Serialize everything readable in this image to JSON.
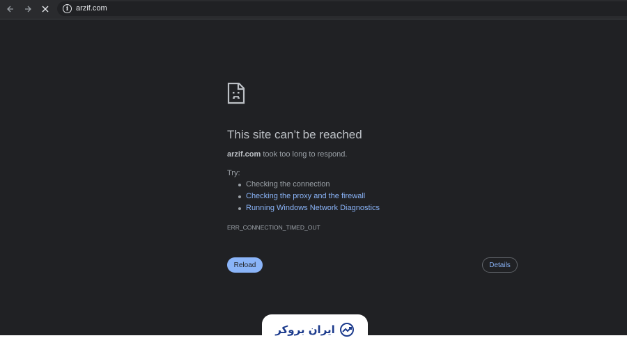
{
  "browser": {
    "back_icon": "arrow-left-icon",
    "forward_icon": "arrow-right-icon",
    "stop_icon": "close-icon",
    "info_icon": "info-icon",
    "url": "arzif.com"
  },
  "error_page": {
    "icon": "sad-document-icon",
    "title": "This site can’t be reached",
    "domain": "arzif.com",
    "message": " took too long to respond.",
    "try_label": "Try:",
    "suggestions": [
      {
        "label": "Checking the connection",
        "is_link": false
      },
      {
        "label": "Checking the proxy and the firewall",
        "is_link": true
      },
      {
        "label": "Running Windows Network Diagnostics",
        "is_link": true
      }
    ],
    "error_code": "ERR_CONNECTION_TIMED_OUT",
    "reload_label": "Reload",
    "details_label": "Details"
  },
  "watermark": {
    "text": "ایران بروکر",
    "icon": "trend-chart-logo-icon",
    "color": "#1b3a8c"
  },
  "colors": {
    "background": "#202124",
    "link": "#8ab4f8",
    "text": "#9aa0a6",
    "heading": "#bdc1c6"
  }
}
